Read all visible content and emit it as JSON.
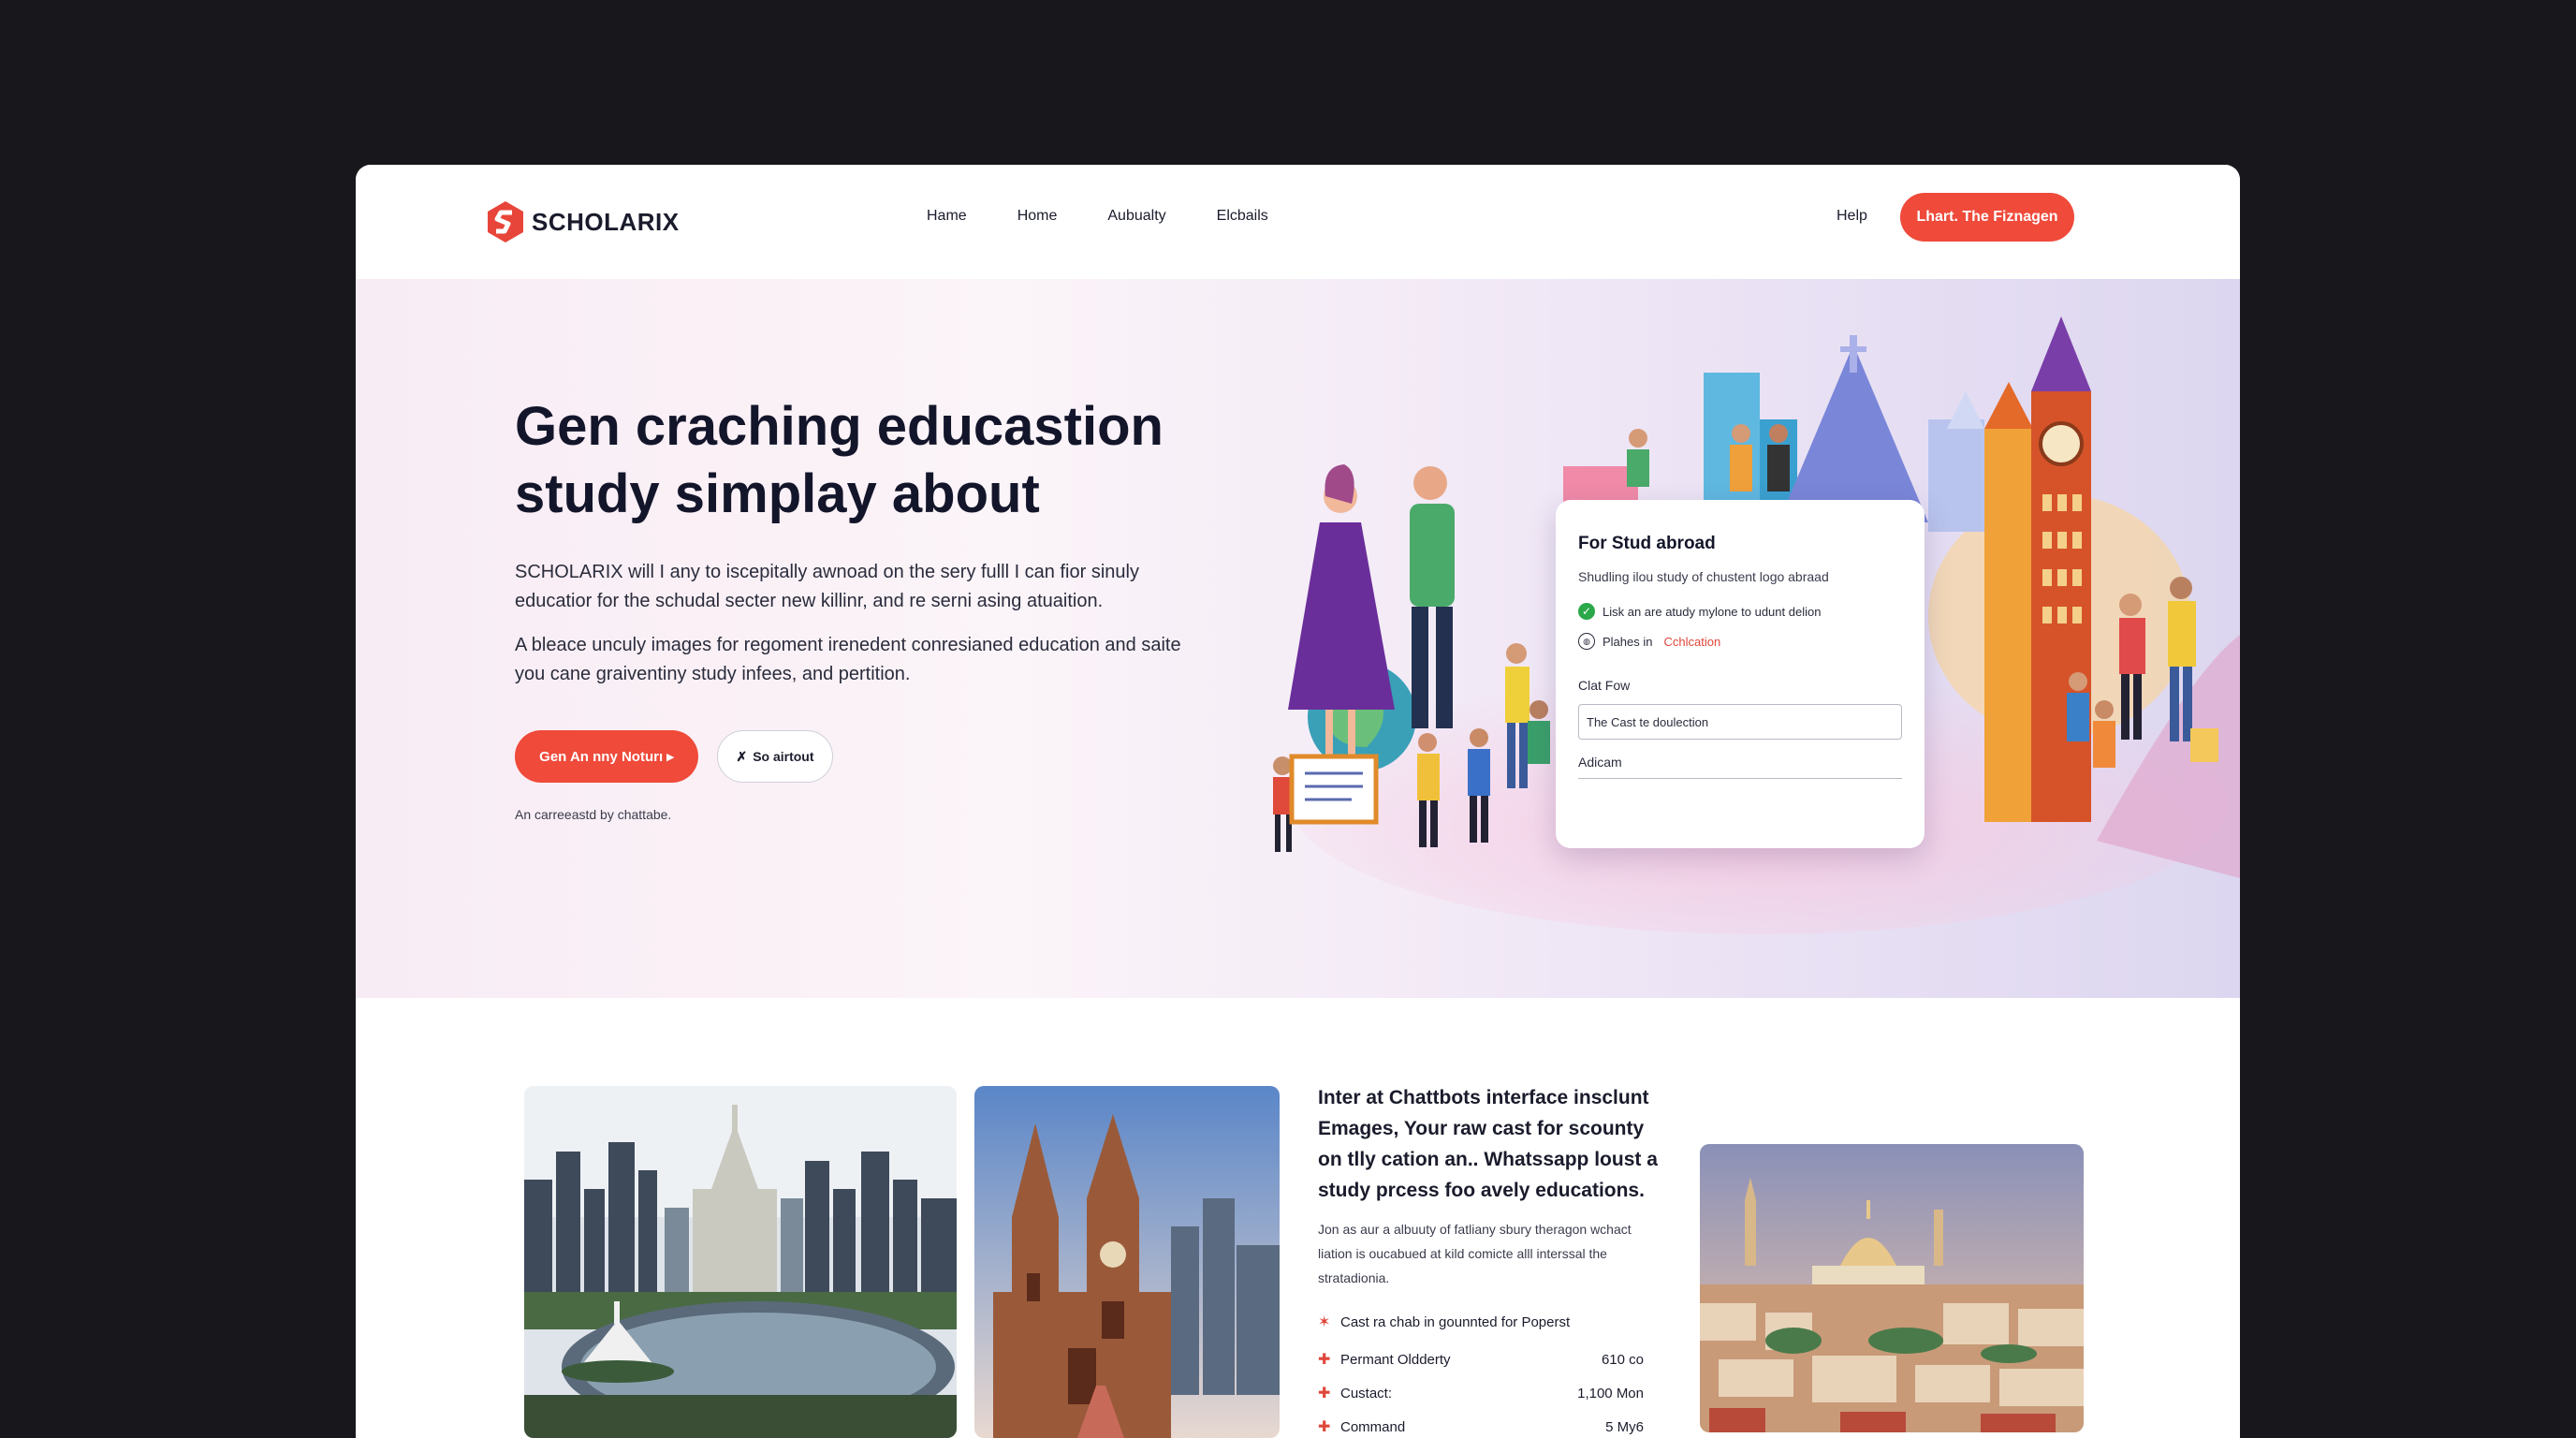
{
  "brand": {
    "name": "SCHOLARIX"
  },
  "nav": {
    "links": [
      "Hame",
      "Home",
      "Aubualty",
      "Elcbails"
    ],
    "help": "Help",
    "cta": "Lhart. The Fiznagen"
  },
  "hero": {
    "title": "Gen craching educastion study simplay about",
    "paragraph1": "SCHOLARIX will I any to iscepitally awnoad on the sery fulll I can fior sinuly educatior for the schudal secter new killinr, and re serni asing atuaition.",
    "paragraph2": "A bleace unculy images for regoment irenedent conresianed education and saite you cane graiventiny study infees, and pertition.",
    "primary_button": "Gen An nny Noturı ▸",
    "secondary_button": "So airtout",
    "note": "An carreeastd by chattabe."
  },
  "chat_card": {
    "title": "For Stud abroad",
    "subtitle": "Shudling ilou study of chustent logo abraad",
    "item1": "Lisk an are atudy mylone to udunt delion",
    "item2_prefix": "Plahes in",
    "item2_accent": "Cchlcation",
    "label": "Clat Fow",
    "input_value": "The Cast te doulection",
    "field_value": "Adicam"
  },
  "info": {
    "title": "Inter at Chattbots interface insclunt Emages, Your raw cast for scounty on tlly cation an.. Whatssapp loust a study prcess foo avely educations.",
    "text": "Jon as aur a albuuty of fatliany sbury theragon wchact liation is oucabued at kild comicte alll interssal the stratadionia.",
    "features": [
      {
        "label": "Cast ra chab in gounnted for Poperst",
        "value": ""
      },
      {
        "label": "Permant Oldderty",
        "value": "610 co"
      },
      {
        "label": "Custact:",
        "value": "1,100 Mon"
      },
      {
        "label": "Command",
        "value": "5 My6"
      }
    ]
  },
  "colors": {
    "accent": "#ef4a3a",
    "page_bg": "#18181c",
    "dark_text": "#13152a"
  }
}
